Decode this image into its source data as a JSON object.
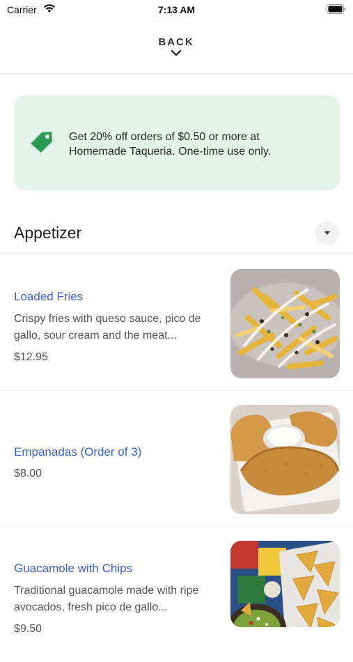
{
  "status_bar": {
    "carrier": "Carrier",
    "time": "7:13 AM"
  },
  "header": {
    "back_label": "BACK"
  },
  "promo": {
    "text": "Get 20% off orders of $0.50 or more at Homemade Taqueria. One-time use only.",
    "accent_color": "#2e9a55",
    "background": "#e3f3ea"
  },
  "section": {
    "title": "Appetizer"
  },
  "items": [
    {
      "name": "Loaded Fries",
      "description": "Crispy fries with queso sauce, pico de gallo, sour cream and the meat...",
      "price": "$12.95"
    },
    {
      "name": "Empanadas (Order of 3)",
      "description": "",
      "price": "$8.00"
    },
    {
      "name": "Guacamole with Chips",
      "description": "Traditional guacamole made with ripe avocados, fresh pico de gallo...",
      "price": "$9.50"
    }
  ],
  "colors": {
    "link": "#3a5fd9",
    "divider": "#ececec"
  }
}
